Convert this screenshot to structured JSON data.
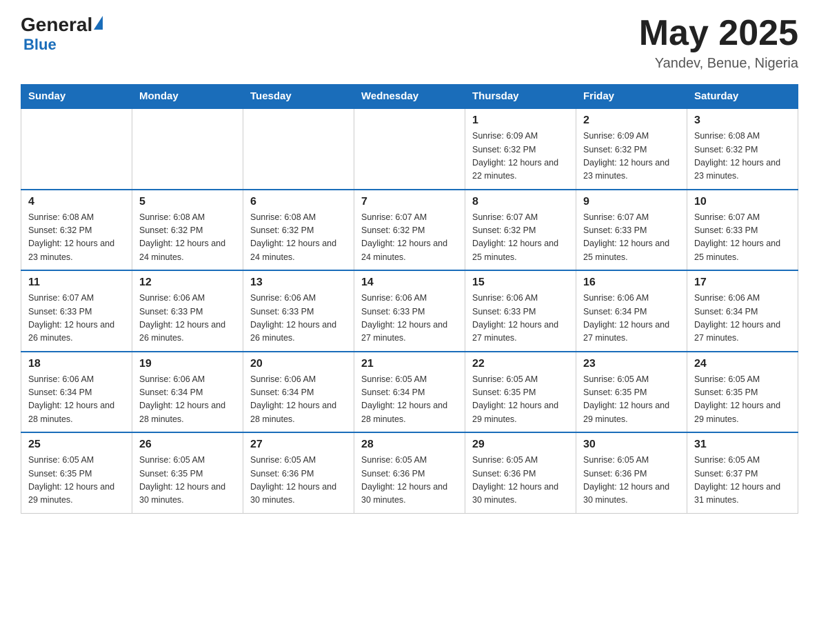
{
  "header": {
    "logo_general": "General",
    "logo_blue": "Blue",
    "title": "May 2025",
    "subtitle": "Yandev, Benue, Nigeria"
  },
  "weekdays": [
    "Sunday",
    "Monday",
    "Tuesday",
    "Wednesday",
    "Thursday",
    "Friday",
    "Saturday"
  ],
  "weeks": [
    {
      "days": [
        {
          "num": "",
          "info": ""
        },
        {
          "num": "",
          "info": ""
        },
        {
          "num": "",
          "info": ""
        },
        {
          "num": "",
          "info": ""
        },
        {
          "num": "1",
          "info": "Sunrise: 6:09 AM\nSunset: 6:32 PM\nDaylight: 12 hours and 22 minutes."
        },
        {
          "num": "2",
          "info": "Sunrise: 6:09 AM\nSunset: 6:32 PM\nDaylight: 12 hours and 23 minutes."
        },
        {
          "num": "3",
          "info": "Sunrise: 6:08 AM\nSunset: 6:32 PM\nDaylight: 12 hours and 23 minutes."
        }
      ]
    },
    {
      "days": [
        {
          "num": "4",
          "info": "Sunrise: 6:08 AM\nSunset: 6:32 PM\nDaylight: 12 hours and 23 minutes."
        },
        {
          "num": "5",
          "info": "Sunrise: 6:08 AM\nSunset: 6:32 PM\nDaylight: 12 hours and 24 minutes."
        },
        {
          "num": "6",
          "info": "Sunrise: 6:08 AM\nSunset: 6:32 PM\nDaylight: 12 hours and 24 minutes."
        },
        {
          "num": "7",
          "info": "Sunrise: 6:07 AM\nSunset: 6:32 PM\nDaylight: 12 hours and 24 minutes."
        },
        {
          "num": "8",
          "info": "Sunrise: 6:07 AM\nSunset: 6:32 PM\nDaylight: 12 hours and 25 minutes."
        },
        {
          "num": "9",
          "info": "Sunrise: 6:07 AM\nSunset: 6:33 PM\nDaylight: 12 hours and 25 minutes."
        },
        {
          "num": "10",
          "info": "Sunrise: 6:07 AM\nSunset: 6:33 PM\nDaylight: 12 hours and 25 minutes."
        }
      ]
    },
    {
      "days": [
        {
          "num": "11",
          "info": "Sunrise: 6:07 AM\nSunset: 6:33 PM\nDaylight: 12 hours and 26 minutes."
        },
        {
          "num": "12",
          "info": "Sunrise: 6:06 AM\nSunset: 6:33 PM\nDaylight: 12 hours and 26 minutes."
        },
        {
          "num": "13",
          "info": "Sunrise: 6:06 AM\nSunset: 6:33 PM\nDaylight: 12 hours and 26 minutes."
        },
        {
          "num": "14",
          "info": "Sunrise: 6:06 AM\nSunset: 6:33 PM\nDaylight: 12 hours and 27 minutes."
        },
        {
          "num": "15",
          "info": "Sunrise: 6:06 AM\nSunset: 6:33 PM\nDaylight: 12 hours and 27 minutes."
        },
        {
          "num": "16",
          "info": "Sunrise: 6:06 AM\nSunset: 6:34 PM\nDaylight: 12 hours and 27 minutes."
        },
        {
          "num": "17",
          "info": "Sunrise: 6:06 AM\nSunset: 6:34 PM\nDaylight: 12 hours and 27 minutes."
        }
      ]
    },
    {
      "days": [
        {
          "num": "18",
          "info": "Sunrise: 6:06 AM\nSunset: 6:34 PM\nDaylight: 12 hours and 28 minutes."
        },
        {
          "num": "19",
          "info": "Sunrise: 6:06 AM\nSunset: 6:34 PM\nDaylight: 12 hours and 28 minutes."
        },
        {
          "num": "20",
          "info": "Sunrise: 6:06 AM\nSunset: 6:34 PM\nDaylight: 12 hours and 28 minutes."
        },
        {
          "num": "21",
          "info": "Sunrise: 6:05 AM\nSunset: 6:34 PM\nDaylight: 12 hours and 28 minutes."
        },
        {
          "num": "22",
          "info": "Sunrise: 6:05 AM\nSunset: 6:35 PM\nDaylight: 12 hours and 29 minutes."
        },
        {
          "num": "23",
          "info": "Sunrise: 6:05 AM\nSunset: 6:35 PM\nDaylight: 12 hours and 29 minutes."
        },
        {
          "num": "24",
          "info": "Sunrise: 6:05 AM\nSunset: 6:35 PM\nDaylight: 12 hours and 29 minutes."
        }
      ]
    },
    {
      "days": [
        {
          "num": "25",
          "info": "Sunrise: 6:05 AM\nSunset: 6:35 PM\nDaylight: 12 hours and 29 minutes."
        },
        {
          "num": "26",
          "info": "Sunrise: 6:05 AM\nSunset: 6:35 PM\nDaylight: 12 hours and 30 minutes."
        },
        {
          "num": "27",
          "info": "Sunrise: 6:05 AM\nSunset: 6:36 PM\nDaylight: 12 hours and 30 minutes."
        },
        {
          "num": "28",
          "info": "Sunrise: 6:05 AM\nSunset: 6:36 PM\nDaylight: 12 hours and 30 minutes."
        },
        {
          "num": "29",
          "info": "Sunrise: 6:05 AM\nSunset: 6:36 PM\nDaylight: 12 hours and 30 minutes."
        },
        {
          "num": "30",
          "info": "Sunrise: 6:05 AM\nSunset: 6:36 PM\nDaylight: 12 hours and 30 minutes."
        },
        {
          "num": "31",
          "info": "Sunrise: 6:05 AM\nSunset: 6:37 PM\nDaylight: 12 hours and 31 minutes."
        }
      ]
    }
  ]
}
